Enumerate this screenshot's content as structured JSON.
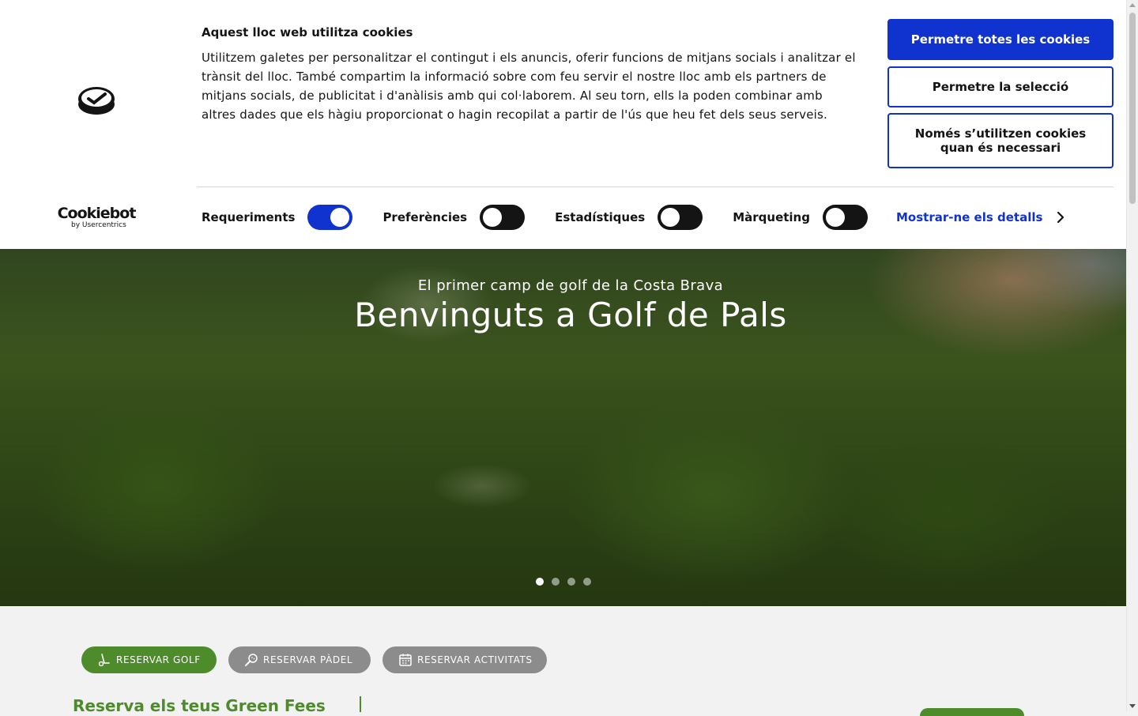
{
  "cookie": {
    "title": "Aquest lloc web utilitza cookies",
    "text": "Utilitzem galetes per personalitzar el contingut i els anuncis, oferir funcions de mitjans socials i analitzar el trànsit del lloc. També compartim la informació sobre com feu servir el nostre lloc amb els partners de mitjans socials, de publicitat i d'anàlisis amb qui col·laborem. Al seu torn, ells la poden combinar amb altres dades que els hàgiu proporcionat o hagin recopilat a partir de l'ús que heu fet dels seus serveis.",
    "brand": "Cookiebot",
    "brand_sub": "by Usercentrics",
    "allow_all": "Permetre totes les cookies",
    "allow_selection": "Permetre la selecció",
    "necessary_only": "Només s’utilitzen cookies quan és necessari",
    "toggles": [
      {
        "label": "Requeriments",
        "on": true
      },
      {
        "label": "Preferències",
        "on": false
      },
      {
        "label": "Estadístiques",
        "on": false
      },
      {
        "label": "Màrqueting",
        "on": false
      }
    ],
    "details": "Mostrar-ne els detalls",
    "accent_color": "#1032cf"
  },
  "hero": {
    "subtitle": "El primer camp de golf de la Costa Brava",
    "title": "Benvinguts a Golf de Pals",
    "slides": 4,
    "active_slide": 1
  },
  "booking": {
    "buttons": [
      {
        "label": "RESERVAR GOLF",
        "icon": "golf-trolley-icon",
        "color": "#4e8b2a"
      },
      {
        "label": "RESERVAR PÀDEL",
        "icon": "padel-racket-icon",
        "color": "#8c8c8c"
      },
      {
        "label": "RESERVAR ACTIVITATS",
        "icon": "calendar-icon",
        "color": "#8c8c8c"
      }
    ],
    "title": "Reserva els teus Green Fees"
  }
}
